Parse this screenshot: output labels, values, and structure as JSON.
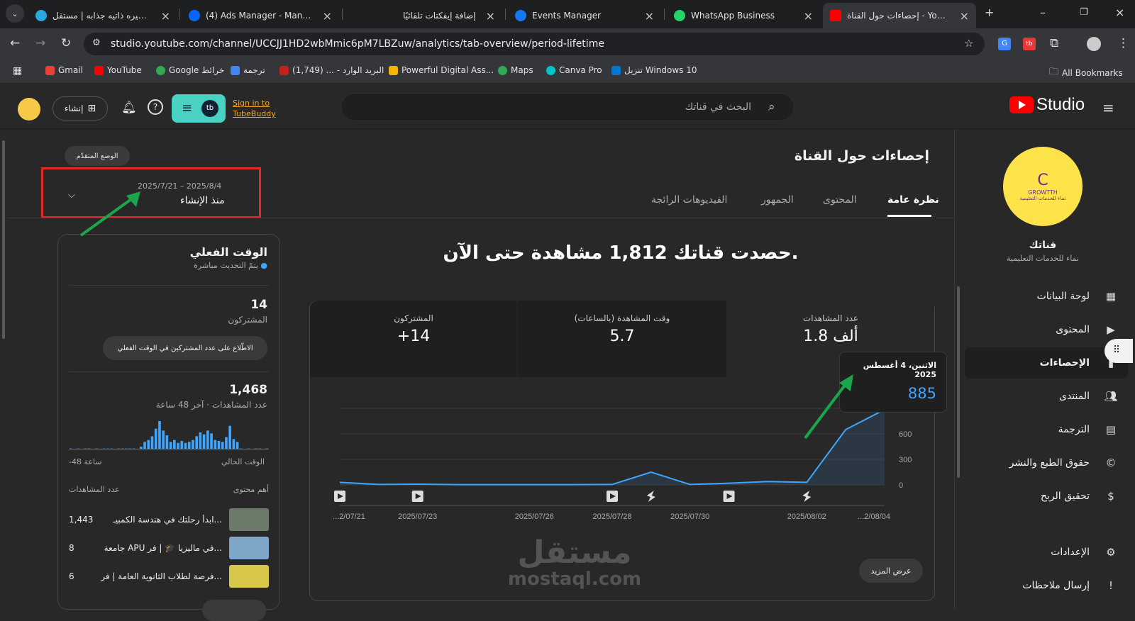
{
  "browser": {
    "tabs": [
      {
        "title": "عمل سيره ذاتيه جذابه | مستقل",
        "icon": "mostaql-icon"
      },
      {
        "title": "(4) Ads Manager - Manage ads",
        "icon": "meta-icon"
      },
      {
        "title": "إضافة إيفكتات تلقائيًا",
        "icon": "page-icon"
      },
      {
        "title": "Events Manager",
        "icon": "facebook-icon"
      },
      {
        "title": "WhatsApp Business",
        "icon": "whatsapp-icon"
      },
      {
        "title": "إحصاءات حول القناة - YouTube Studio",
        "icon": "youtube-icon",
        "active": true
      }
    ],
    "url": "studio.youtube.com/channel/UCCJJ1HD2wbMmic6pM7LBZuw/analytics/tab-overview/period-lifetime",
    "bookmarks": [
      "Gmail",
      "YouTube",
      "Google خرائط",
      "ترجمة",
      "البريد الوارد - ... (1,749)",
      "Powerful Digital Ass...",
      "Maps",
      "Canva Pro",
      "تنزيل Windows 10"
    ],
    "all_bookmarks": "All Bookmarks"
  },
  "header": {
    "search_placeholder": "البحث في قناتك",
    "create_label": "إنشاء",
    "tubebuddy_link_1": "Sign in to",
    "tubebuddy_link_2": "TubeBuddy",
    "logo_text": "Studio"
  },
  "sidebar": {
    "channel_name": "قناتك",
    "channel_sub": "نماء للخدمات التعليمية",
    "avatar_text": "GROWTTH",
    "avatar_sub": "نماء للخدمات التعليمية",
    "items": [
      {
        "label": "لوحة البيانات",
        "icon": "dashboard-icon"
      },
      {
        "label": "المحتوى",
        "icon": "content-icon"
      },
      {
        "label": "الإحصاءات",
        "icon": "analytics-icon",
        "active": true
      },
      {
        "label": "المنتدى",
        "icon": "community-icon"
      },
      {
        "label": "الترجمة",
        "icon": "subtitles-icon"
      },
      {
        "label": "حقوق الطبع والنشر",
        "icon": "copyright-icon"
      },
      {
        "label": "تحقيق الربح",
        "icon": "monetization-icon"
      },
      {
        "label": "الإعدادات",
        "icon": "settings-icon"
      },
      {
        "label": "إرسال ملاحظات",
        "icon": "feedback-icon"
      }
    ]
  },
  "analytics": {
    "title": "إحصاءات حول القناة",
    "advanced_mode": "الوضع المتقدّم",
    "period_range": "2025/7/21 – 2025/8/4",
    "period_label": "منذ الإنشاء",
    "tabs": [
      "نظرة عامة",
      "المحتوى",
      "الجمهور",
      "الفيديوهات الرائجة"
    ],
    "headline": "حصدت قناتك 1,812 مشاهدة حتى الآن.",
    "metrics": [
      {
        "label": "عدد المشاهدات",
        "value": "1.8 ألف"
      },
      {
        "label": "وقت المشاهدة (بالساعات)",
        "value": "5.7"
      },
      {
        "label": "المشتركون",
        "value": "+14"
      }
    ],
    "tooltip_date": "الاثنين، 4 أغسطس 2025",
    "tooltip_value": "885",
    "see_more": "عرض المزيد"
  },
  "chart_data": {
    "type": "line",
    "x": [
      "2025/07/21",
      "2025/07/22",
      "2025/07/23",
      "2025/07/24",
      "2025/07/25",
      "2025/07/26",
      "2025/07/27",
      "2025/07/28",
      "2025/07/29",
      "2025/07/30",
      "2025/07/31",
      "2025/08/01",
      "2025/08/02",
      "2025/08/03",
      "2025/08/04"
    ],
    "series": [
      {
        "values": [
          30,
          5,
          8,
          3,
          3,
          3,
          3,
          5,
          150,
          5,
          20,
          40,
          30,
          650,
          885
        ]
      }
    ],
    "x_tick_labels": [
      "...2/07/21",
      "2025/07/23",
      "2025/07/26",
      "2025/07/28",
      "2025/07/30",
      "2025/08/02",
      "...2/08/04"
    ],
    "y_ticks": [
      0,
      300,
      600,
      900
    ],
    "ylim": [
      0,
      900
    ],
    "color": "#3ea6ff",
    "markers": [
      {
        "x": "2025/07/21",
        "type": "video"
      },
      {
        "x": "2025/07/23",
        "type": "video"
      },
      {
        "x": "2025/07/28",
        "type": "video"
      },
      {
        "x": "2025/07/29",
        "type": "short"
      },
      {
        "x": "2025/07/31",
        "type": "video"
      },
      {
        "x": "2025/08/02",
        "type": "short"
      }
    ]
  },
  "realtime": {
    "title": "الوقت الفعلي",
    "live": "يتمّ التحديث مباشرة",
    "subs_value": "14",
    "subs_label": "المشتركون",
    "subs_pill": "الاطّلاع على عدد المشتركين في الوقت الفعلي",
    "views_value": "1,468",
    "views_label": "عدد المشاهدات · آخر 48 ساعة",
    "axis_now": "الوقت الحالي",
    "axis_ago": "-48 ساعة",
    "top_header_left": "أهم محتوى",
    "top_header_right": "عدد المشاهدات",
    "bars": [
      1,
      0,
      1,
      0,
      1,
      1,
      0,
      1,
      0,
      1,
      1,
      1,
      0,
      1,
      1,
      1,
      1,
      1,
      0,
      3,
      8,
      10,
      14,
      22,
      30,
      20,
      15,
      8,
      10,
      7,
      9,
      7,
      8,
      10,
      14,
      18,
      16,
      20,
      17,
      10,
      9,
      8,
      13,
      25,
      11,
      8,
      1,
      0,
      1,
      0,
      1,
      1,
      0,
      1
    ],
    "top_content": [
      {
        "title": "ابدأ رحلتك في هندسة الكمبيـ...",
        "views": "1,443"
      },
      {
        "title": "جامعة APU في ماليزيا 🎓 | فر...",
        "views": "8"
      },
      {
        "title": "فرصة لطلاب الثانوية العامة | فر...",
        "views": "6"
      }
    ]
  },
  "watermark": {
    "line1": "مستقل",
    "line2": "mostaql.com"
  }
}
